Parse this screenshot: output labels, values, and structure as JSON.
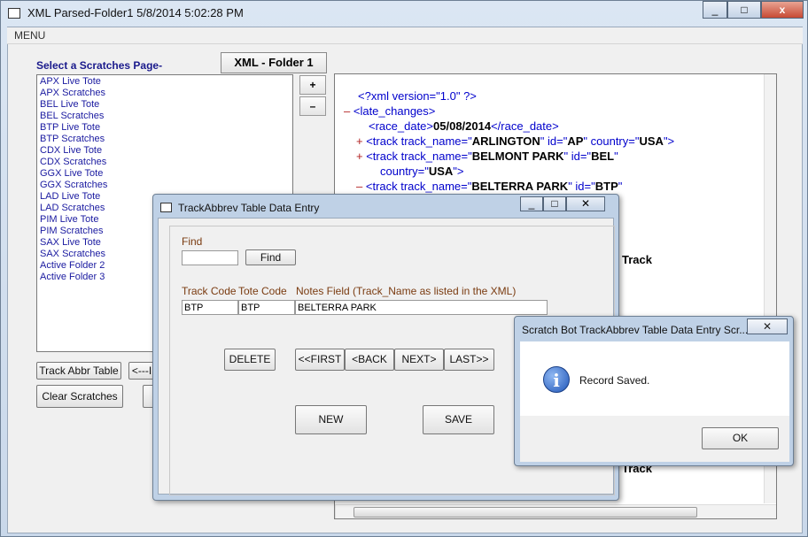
{
  "main": {
    "title": "XML Parsed-Folder1 5/8/2014 5:02:28 PM",
    "menu": "MENU",
    "minimize": "_",
    "maximize": "□",
    "close": "x",
    "select_label": "Select a Scratches Page-",
    "xml_tab": "XML - Folder 1",
    "plus": "+",
    "minus": "–",
    "list_items": [
      "APX Live Tote",
      "APX Scratches",
      "BEL Live Tote",
      "BEL Scratches",
      "BTP Live Tote",
      "BTP Scratches",
      "CDX Live Tote",
      "CDX Scratches",
      "GGX Live Tote",
      "GGX Scratches",
      "LAD Live Tote",
      "LAD Scratches",
      "PIM Live Tote",
      "PIM Scratches",
      "SAX Live Tote",
      "SAX Scratches",
      "Active Folder 2",
      "Active Folder 3"
    ],
    "track_abbr_button": "Track Abbr Table",
    "back_button_partial": "<---I",
    "clear_scratches_button": "Clear Scratches"
  },
  "xml": {
    "decl": "<?xml version=\"1.0\" ?>",
    "root_open": "<late_changes>",
    "race_date_open": "<race_date>",
    "race_date_value": "05/08/2014",
    "race_date_close": "</race_date>",
    "track1_prefix": "<track track_name=\"",
    "track1_name": "ARLINGTON",
    "track1_mid": "\" id=\"",
    "track1_id": "AP",
    "track1_mid2": "\" country=\"",
    "track1_country": "USA",
    "track1_end": "\">",
    "track2_prefix": "<track track_name=\"",
    "track2_name": "BELMONT PARK",
    "track2_mid": "\" id=\"",
    "track2_id": "BEL",
    "track2_end": "\"",
    "track2_line2_prefix": "country=\"",
    "track2_country": "USA",
    "track2_line2_end": "\">",
    "track3_prefix": "<track track_name=\"",
    "track3_name": "BELTERRA PARK",
    "track3_mid": "\" id=\"",
    "track3_id": "BTP",
    "track3_end": "\"",
    "partial_track_1": "Track",
    "partial_track_2": "Track",
    "plus_marker": "+",
    "minus_marker": "–"
  },
  "entry_window": {
    "title": "TrackAbbrev Table Data Entry",
    "find_label": "Find",
    "find_value": "",
    "find_button": "Find",
    "col_track_code": "Track Code",
    "col_tote_code": "Tote Code",
    "col_notes": "Notes Field (Track_Name as listed in the XML)",
    "track_code_value": "BTP",
    "tote_code_value": "BTP",
    "notes_value": "BELTERRA PARK",
    "delete_button": "DELETE",
    "first_button": "<<FIRST",
    "back_button": "<BACK",
    "next_button": "NEXT>",
    "last_button": "LAST>>",
    "new_button": "NEW",
    "save_button": "SAVE"
  },
  "dialog": {
    "title": "Scratch Bot TrackAbbrev Table Data Entry Scr...",
    "message": "Record Saved.",
    "ok_button": "OK",
    "close": "✕"
  }
}
